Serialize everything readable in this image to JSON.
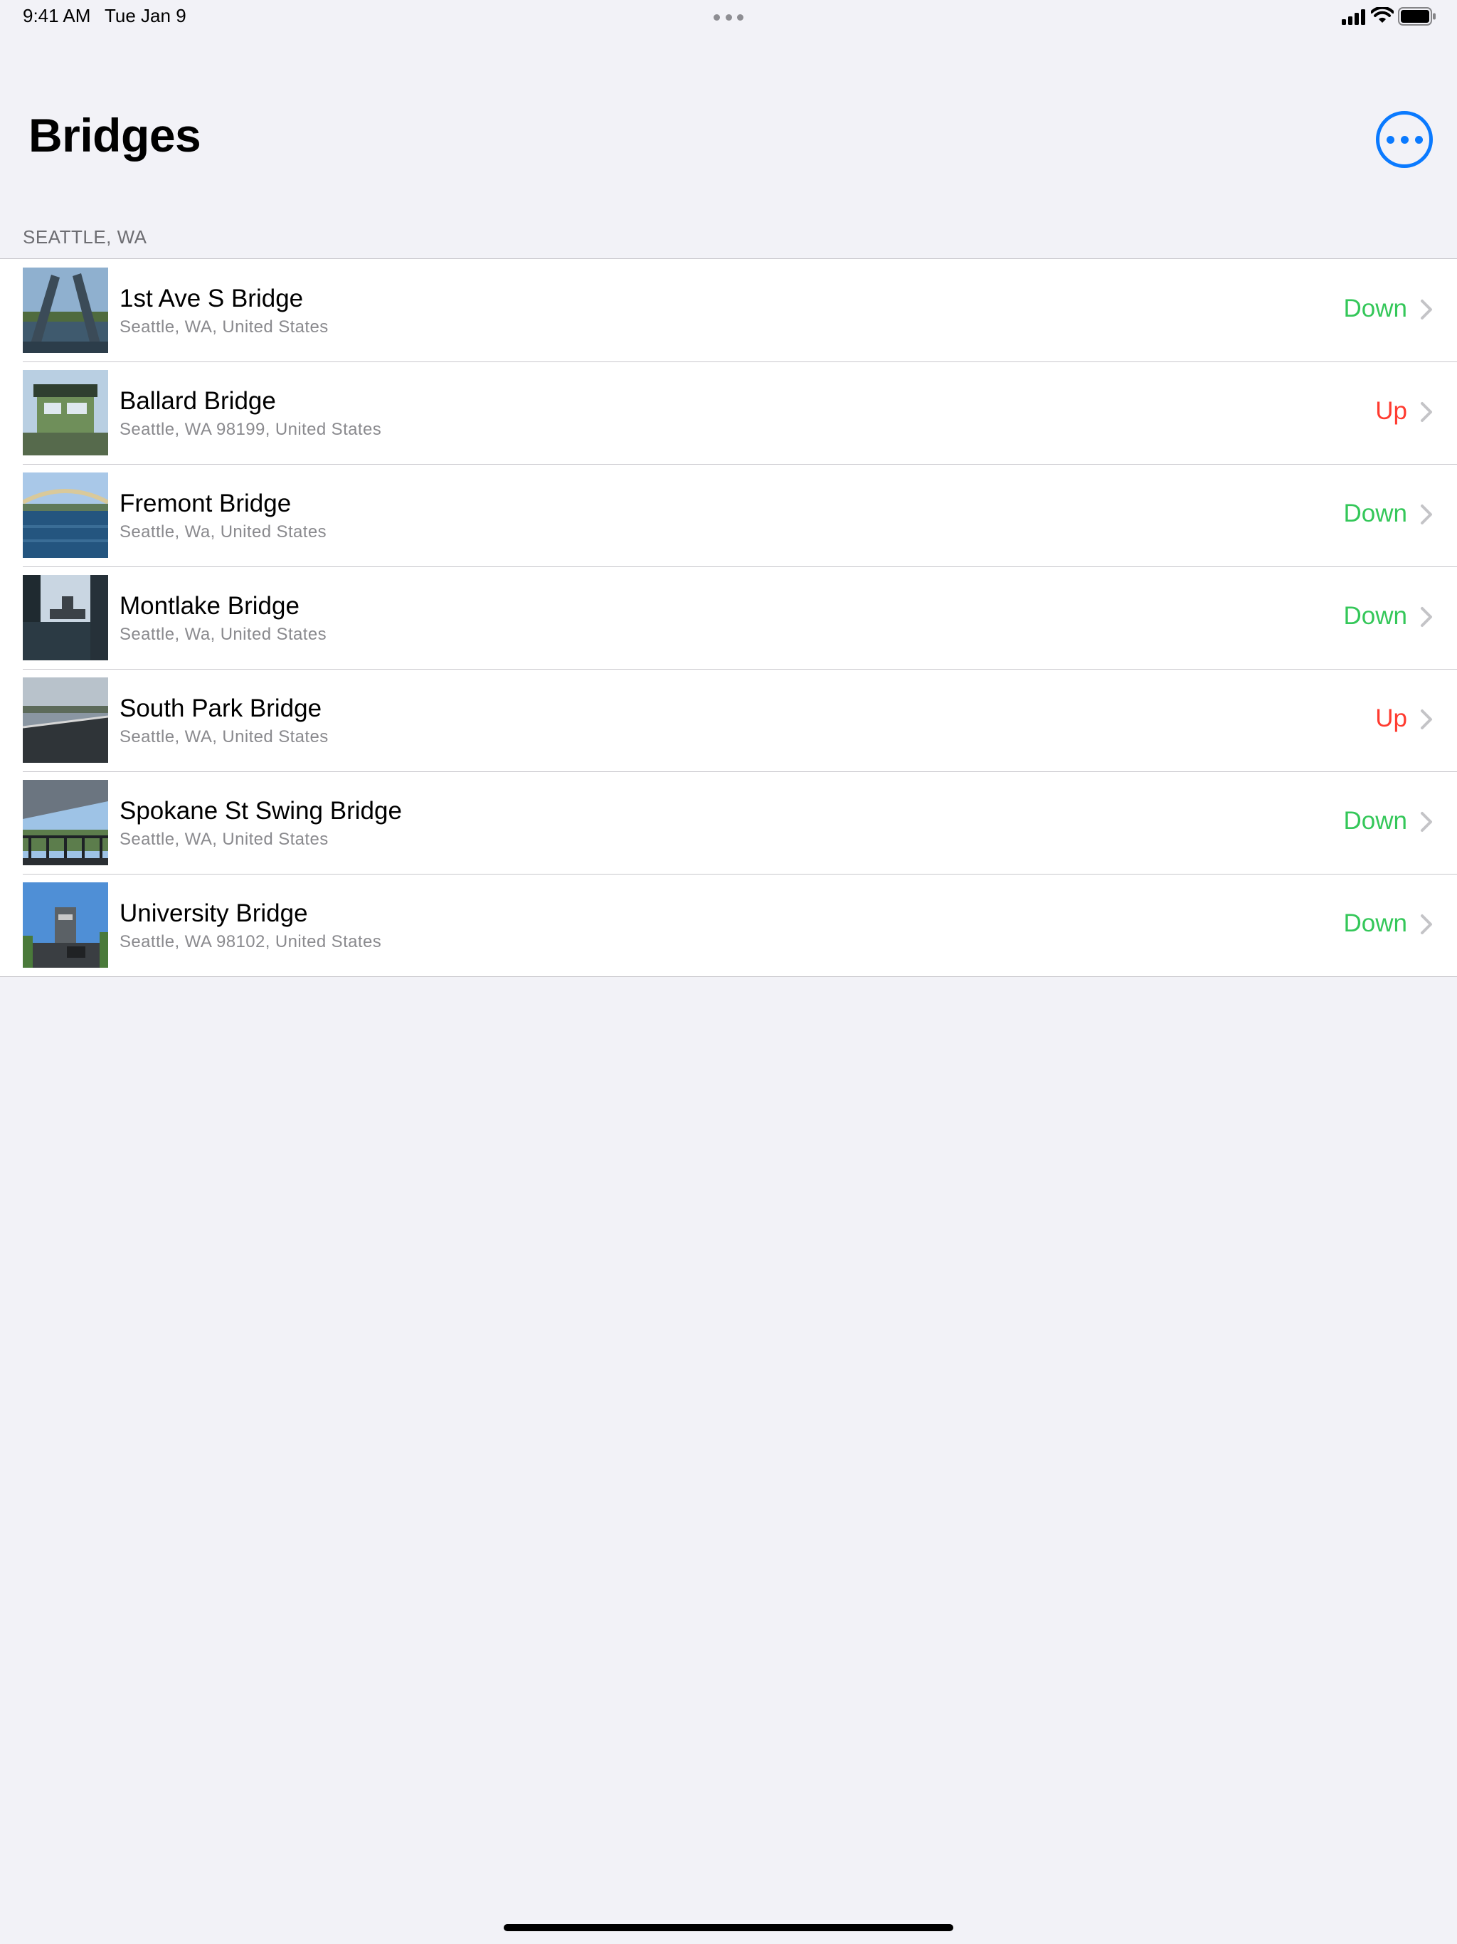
{
  "status_bar": {
    "time": "9:41 AM",
    "date": "Tue Jan 9",
    "icons": [
      "multitasking-dots-icon",
      "cellular-signal-icon",
      "wifi-icon",
      "battery-icon"
    ]
  },
  "header": {
    "title": "Bridges",
    "more_button_icon": "ellipsis-circle-icon",
    "accent_color": "#0a7aff"
  },
  "section": {
    "header": "SEATTLE, WA"
  },
  "status_colors": {
    "Down": "#34c759",
    "Up": "#ff3b30"
  },
  "bridges": [
    {
      "name": "1st Ave S Bridge",
      "address": "Seattle, WA, United States",
      "status": "Down"
    },
    {
      "name": "Ballard Bridge",
      "address": "Seattle, WA 98199, United States",
      "status": "Up"
    },
    {
      "name": "Fremont Bridge",
      "address": "Seattle, Wa, United States",
      "status": "Down"
    },
    {
      "name": "Montlake Bridge",
      "address": "Seattle, Wa, United States",
      "status": "Down"
    },
    {
      "name": "South Park Bridge",
      "address": "Seattle, WA, United States",
      "status": "Up"
    },
    {
      "name": "Spokane St Swing Bridge",
      "address": "Seattle, WA, United States",
      "status": "Down"
    },
    {
      "name": "University Bridge",
      "address": "Seattle, WA  98102, United States",
      "status": "Down"
    }
  ]
}
